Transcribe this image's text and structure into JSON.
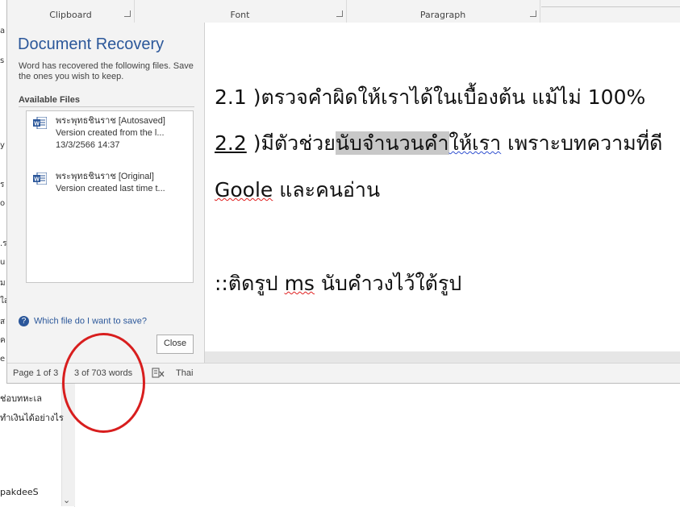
{
  "ribbon": {
    "groups": [
      {
        "label": "Clipboard"
      },
      {
        "label": "Font"
      },
      {
        "label": "Paragraph"
      }
    ]
  },
  "recovery": {
    "title": "Document Recovery",
    "subtitle": "Word has recovered the following files. Save the ones you wish to keep.",
    "files_label": "Available Files",
    "files": [
      {
        "name": "พระพุทธชินราช  [Autosaved]",
        "desc": "Version created from the l...",
        "date": "13/3/2566 14:37"
      },
      {
        "name": "พระพุทธชินราช  [Original]",
        "desc": "Version created last time t..."
      }
    ],
    "help_link": "Which file do I want to save?",
    "close_label": "Close"
  },
  "document": {
    "line1": "2.1 )ตรวจคำผิดให้เราได้ในเบื้องต้น แม้ไม่ 100%",
    "line2_a": "2.2",
    "line2_b": " )มีตัวช่วย",
    "line2_c": "นับจำนวนคำ",
    "line2_d": "ให้เรา",
    "line2_e": " เพราะบทความที่ดี",
    "line3_a": "Goole",
    "line3_b": " และคนอ่าน",
    "line4_a": "::ติดรูป ",
    "line4_b": "ms",
    "line4_c": " นับคำวงไว้ใต้รูป"
  },
  "status": {
    "page": "Page 1 of 3",
    "words": "3 of 703 words",
    "language": "Thai"
  },
  "background": {
    "line1": "ช่อบทหะเล",
    "line2": "ทำเงินได้อย่างไร",
    "line3": "pakdeeS",
    "chars": [
      "a",
      "s",
      "y",
      "ร",
      "o",
      ".ร",
      "u",
      "ม",
      "ใส",
      "ส",
      "ค",
      "e"
    ]
  },
  "colors": {
    "accent": "#2b579a",
    "annotation": "#d81e1e"
  }
}
